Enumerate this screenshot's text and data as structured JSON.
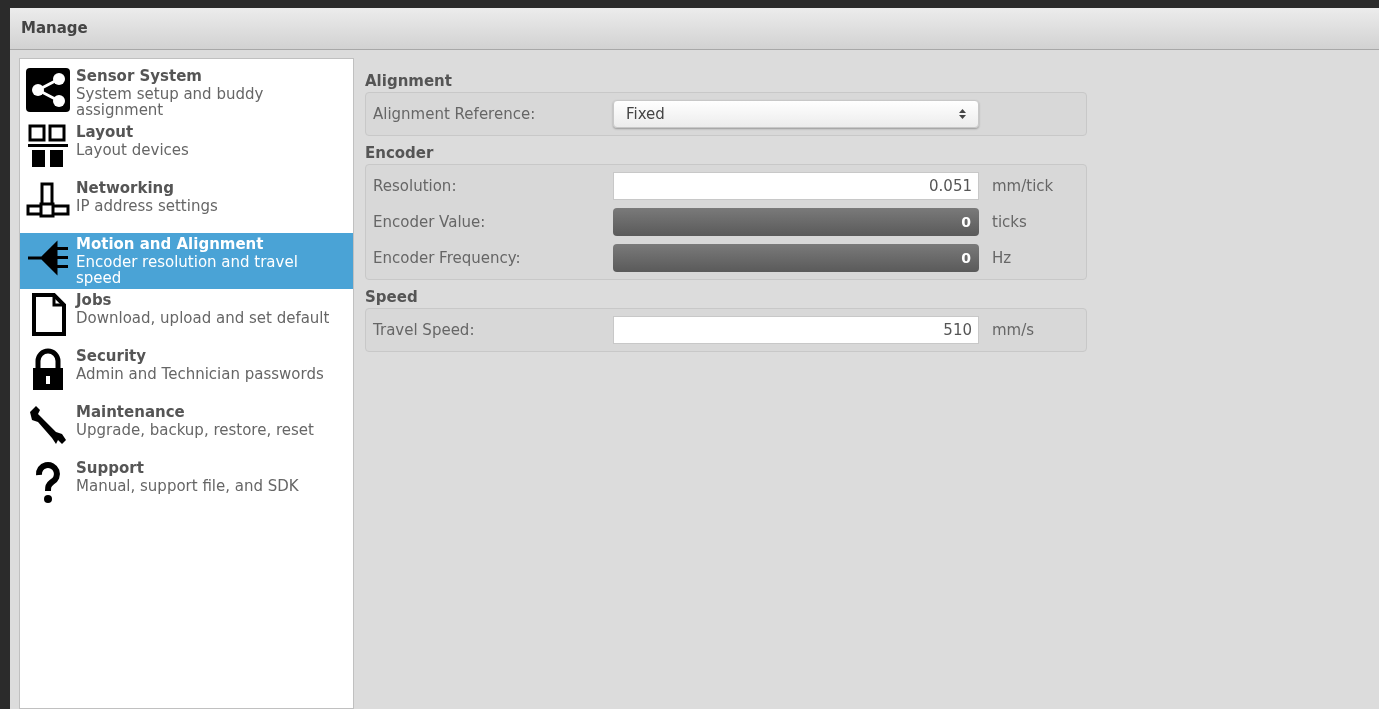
{
  "window": {
    "title": "Manage"
  },
  "sidebar": {
    "items": [
      {
        "title": "Sensor System",
        "subtitle": "System setup and buddy assignment",
        "selected": false
      },
      {
        "title": "Layout",
        "subtitle": "Layout devices",
        "selected": false
      },
      {
        "title": "Networking",
        "subtitle": "IP address settings",
        "selected": false
      },
      {
        "title": "Motion and Alignment",
        "subtitle": "Encoder resolution and travel speed",
        "selected": true
      },
      {
        "title": "Jobs",
        "subtitle": "Download, upload and set default",
        "selected": false
      },
      {
        "title": "Security",
        "subtitle": "Admin and Technician passwords",
        "selected": false
      },
      {
        "title": "Maintenance",
        "subtitle": "Upgrade, backup, restore, reset",
        "selected": false
      },
      {
        "title": "Support",
        "subtitle": "Manual, support file, and SDK",
        "selected": false
      }
    ]
  },
  "sections": [
    {
      "title": "Alignment",
      "rows": [
        {
          "kind": "select",
          "label": "Alignment Reference:",
          "value": "Fixed"
        }
      ]
    },
    {
      "title": "Encoder",
      "rows": [
        {
          "kind": "input",
          "label": "Resolution:",
          "value": "0.051",
          "unit": "mm/tick"
        },
        {
          "kind": "readout",
          "label": "Encoder Value:",
          "value": "0",
          "unit": "ticks"
        },
        {
          "kind": "readout",
          "label": "Encoder Frequency:",
          "value": "0",
          "unit": "Hz"
        }
      ]
    },
    {
      "title": "Speed",
      "rows": [
        {
          "kind": "input",
          "label": "Travel Speed:",
          "value": "510",
          "unit": "mm/s"
        }
      ]
    }
  ]
}
